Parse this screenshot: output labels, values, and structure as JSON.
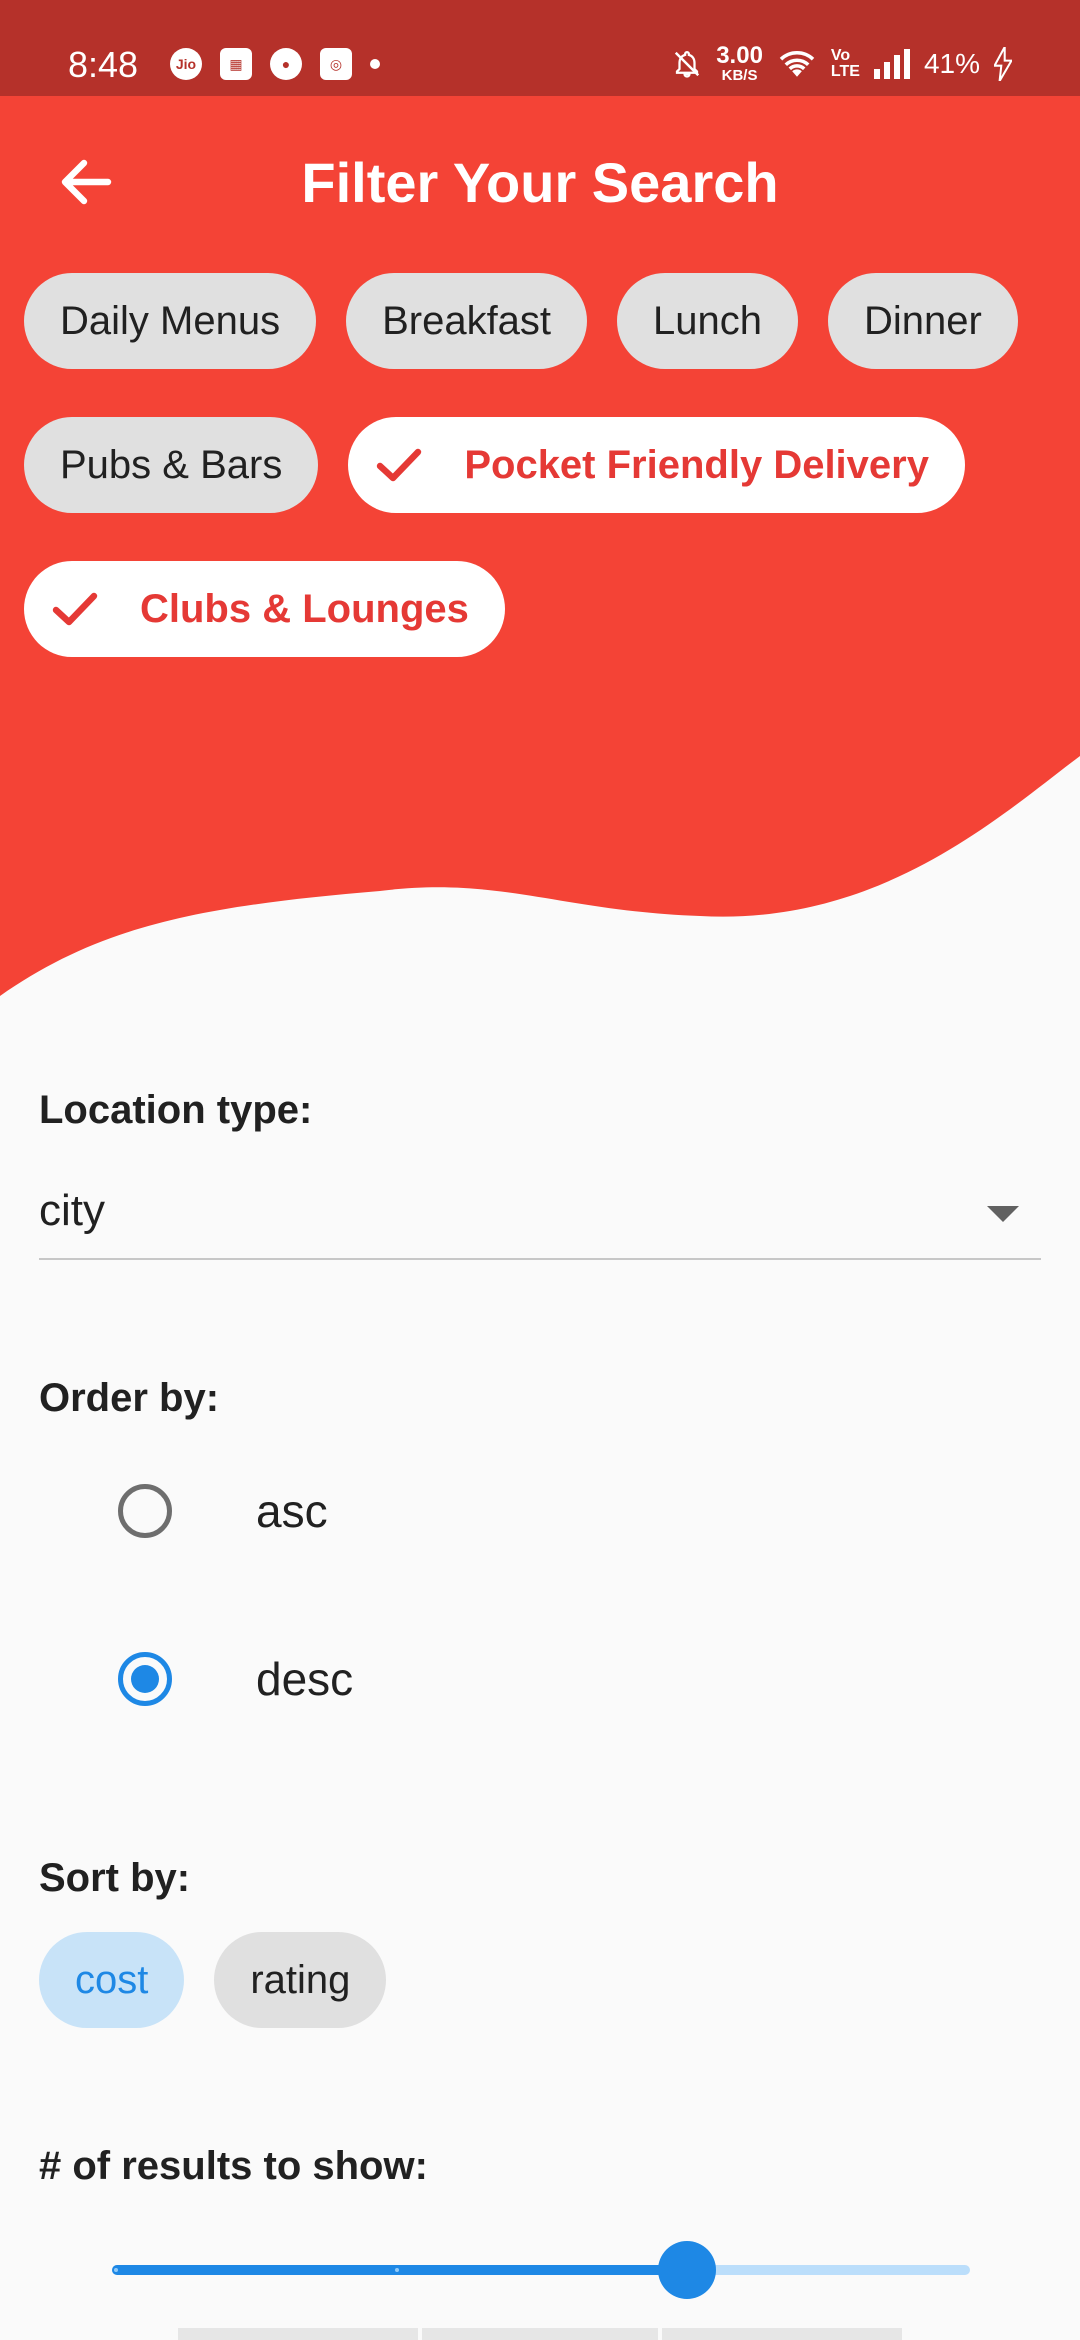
{
  "status_bar": {
    "time": "8:48",
    "left_icons": [
      "jio-icon",
      "gift-icon",
      "palette-icon",
      "instagram-icon",
      "dot-icon"
    ],
    "net_speed_value": "3.00",
    "net_speed_unit": "KB/S",
    "volte_top": "Vo",
    "volte_bottom": "LTE",
    "battery": "41%"
  },
  "header": {
    "title": "Filter Your Search",
    "back_icon": "arrow-left-icon",
    "colors": {
      "primary": "#f44336",
      "status_bar": "#b5312a",
      "chip_selected_text": "#e53935"
    },
    "categories": [
      {
        "label": "Daily Menus",
        "selected": false
      },
      {
        "label": "Breakfast",
        "selected": false
      },
      {
        "label": "Lunch",
        "selected": false
      },
      {
        "label": "Dinner",
        "selected": false
      },
      {
        "label": "Pubs & Bars",
        "selected": false
      },
      {
        "label": "Pocket Friendly Delivery",
        "selected": true
      },
      {
        "label": "Clubs & Lounges",
        "selected": true
      }
    ]
  },
  "location": {
    "label": "Location type:",
    "value": "city"
  },
  "order": {
    "label": "Order by:",
    "options": [
      {
        "label": "asc",
        "selected": false
      },
      {
        "label": "desc",
        "selected": true
      }
    ]
  },
  "sort": {
    "label": "Sort by:",
    "options": [
      {
        "label": "cost",
        "selected": true
      },
      {
        "label": "rating",
        "selected": false
      }
    ]
  },
  "results": {
    "label": "# of results to show:",
    "slider_fraction": 0.67,
    "accent": "#1e88e5"
  }
}
